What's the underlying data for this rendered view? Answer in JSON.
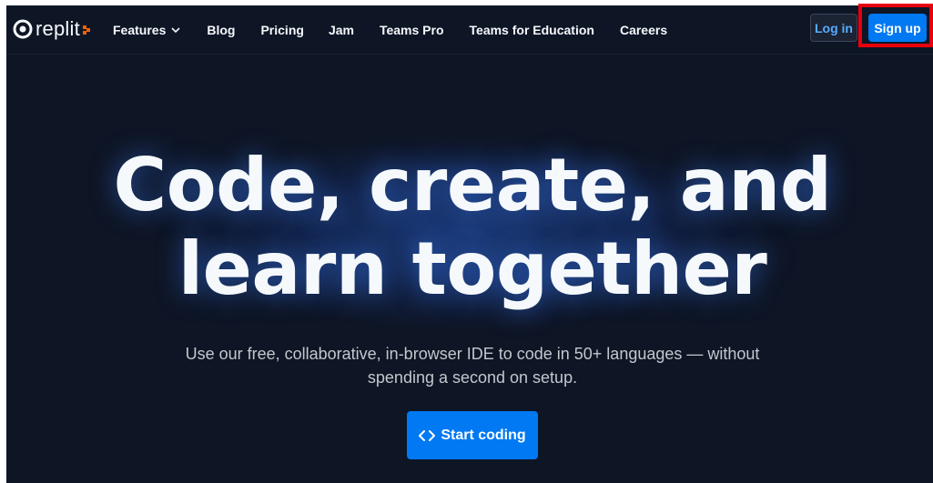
{
  "brand": {
    "name": "replit",
    "accent": "#f26207",
    "icon": "replit-logo-icon"
  },
  "nav": {
    "links": [
      {
        "label": "Features",
        "has_dropdown": true
      },
      {
        "label": "Blog"
      },
      {
        "label": "Pricing"
      },
      {
        "label": "Jam"
      },
      {
        "label": "Teams Pro"
      },
      {
        "label": "Teams for Education"
      },
      {
        "label": "Careers"
      }
    ],
    "login_label": "Log in",
    "signup_label": "Sign up"
  },
  "hero": {
    "headline_line1": "Code, create, and",
    "headline_line2": "learn together",
    "subtitle_line1": "Use our free, collaborative, in-browser IDE to code in 50+ languages — without",
    "subtitle_line2": "spending a second on setup.",
    "cta_label": "Start coding",
    "cta_icon": "code-brackets-icon"
  },
  "colors": {
    "background": "#0e1525",
    "primary_button": "#0079f2",
    "login_text": "#57abff",
    "highlight_box": "#e8000b"
  }
}
